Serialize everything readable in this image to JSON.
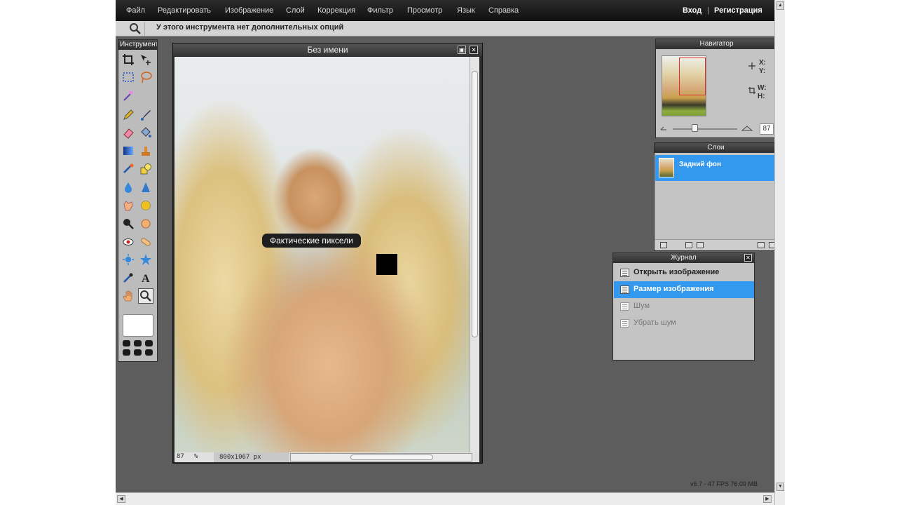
{
  "menu": {
    "items": [
      "Файл",
      "Редактировать",
      "Изображение",
      "Слой",
      "Коррекция",
      "Фильтр",
      "Просмотр",
      "Язык",
      "Справка"
    ],
    "login": "Вход",
    "separator": "|",
    "register": "Регистрация"
  },
  "options_bar": {
    "tool_icon": "magnifier-icon",
    "message": "У этого инструмента нет дополнительных опций"
  },
  "tools_panel": {
    "title": "Инструменты",
    "active_tool": "zoom-tool"
  },
  "document": {
    "title": "Без имени",
    "zoom": "87",
    "zoom_unit": "%",
    "dimensions": "800x1067 px",
    "tooltip": "Фактические пиксели"
  },
  "navigator": {
    "title": "Навигатор",
    "x_label": "X:",
    "y_label": "Y:",
    "w_label": "W:",
    "h_label": "H:",
    "zoom_value": "87",
    "zoom_level": 0.35
  },
  "layers": {
    "title": "Слои",
    "items": [
      {
        "name": "Задний фон",
        "selected": true
      }
    ]
  },
  "history": {
    "title": "Журнал",
    "items": [
      {
        "label": "Открыть изображение",
        "state": "done"
      },
      {
        "label": "Размер изображения",
        "state": "current"
      },
      {
        "label": "Шум",
        "state": "undone"
      },
      {
        "label": "Убрать шум",
        "state": "undone"
      }
    ]
  },
  "status": {
    "fps": "v6.7 - 47 FPS 76.09 MB"
  },
  "colors": {
    "menu_bg": "#1c1c1c",
    "workspace_bg": "#5d5d5d",
    "selection_blue": "#3399ee",
    "panel_bg": "#c4c4c4"
  }
}
